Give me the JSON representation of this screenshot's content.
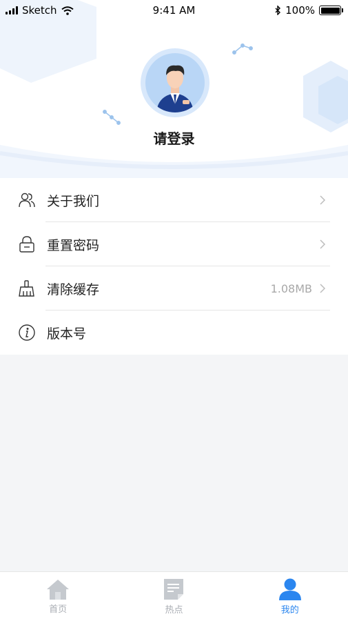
{
  "status_bar": {
    "carrier": "Sketch",
    "time": "9:41 AM",
    "battery": "100%"
  },
  "profile": {
    "login_prompt": "请登录"
  },
  "menu": {
    "items": [
      {
        "label": "关于我们",
        "value": "",
        "icon": "users-icon"
      },
      {
        "label": "重置密码",
        "value": "",
        "icon": "lock-icon"
      },
      {
        "label": "清除缓存",
        "value": "1.08MB",
        "icon": "broom-icon"
      },
      {
        "label": "版本号",
        "value": "",
        "icon": "info-icon"
      }
    ]
  },
  "tabbar": {
    "tabs": [
      {
        "label": "首页",
        "icon": "home-icon",
        "active": false
      },
      {
        "label": "热点",
        "icon": "document-icon",
        "active": false
      },
      {
        "label": "我的",
        "icon": "user-icon",
        "active": true
      }
    ]
  },
  "colors": {
    "accent": "#2b86ef",
    "inactive": "#a9adb3",
    "background": "#f4f5f7"
  }
}
